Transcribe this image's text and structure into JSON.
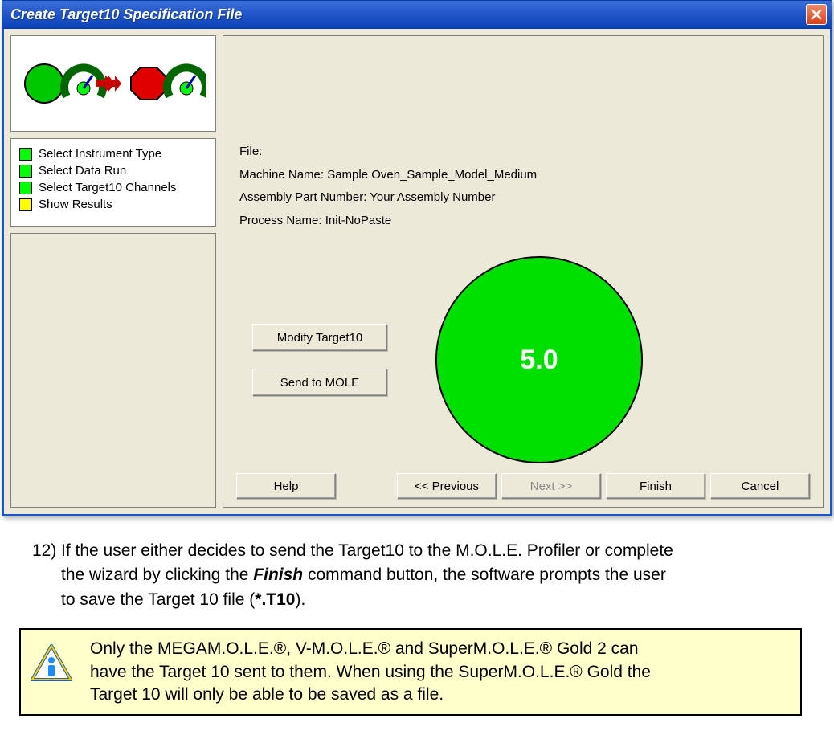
{
  "dialog": {
    "title": "Create Target10 Specification File",
    "steps": [
      {
        "color": "green",
        "label": "Select Instrument Type"
      },
      {
        "color": "green",
        "label": "Select Data Run"
      },
      {
        "color": "green",
        "label": "Select Target10 Channels"
      },
      {
        "color": "yellow",
        "label": "Show Results"
      }
    ],
    "info": {
      "file_label": "File:",
      "machine_label": "Machine Name: Sample Oven_Sample_Model_Medium",
      "assembly_label": "Assembly Part Number: Your Assembly Number",
      "process_label": "Process Name: Init-NoPaste"
    },
    "buttons": {
      "modify": "Modify Target10",
      "send": "Send to MOLE"
    },
    "score": "5.0",
    "nav": {
      "help": "Help",
      "previous": "<< Previous",
      "next": "Next >>",
      "finish": "Finish",
      "cancel": "Cancel"
    }
  },
  "doc": {
    "item_number": "12)",
    "line1": "If the user either decides to send the Target10 to the M.O.L.E. Profiler or complete",
    "line2": "the wizard by clicking the ",
    "finish_word": "Finish",
    "line2b": " command button, the software prompts the user",
    "line3": "to save the Target 10 file (",
    "ext": "*.T10",
    "line3b": ")."
  },
  "note": {
    "text1": "Only the MEGAM.O.L.E.®, V-M.O.L.E.® and SuperM.O.L.E.® Gold 2 can",
    "text2": "have the Target 10 sent to them. When using the SuperM.O.L.E.® Gold the",
    "text3": "Target 10 will only be able to be saved as a file."
  }
}
